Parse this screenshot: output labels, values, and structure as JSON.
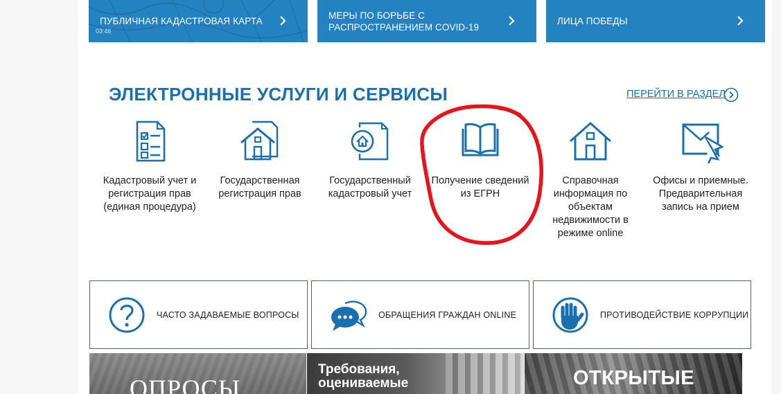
{
  "banners": [
    {
      "label": "Публичная кадастровая карта"
    },
    {
      "label": "Меры по борьбе с распространением COVID-19"
    },
    {
      "label": "Лица победы"
    }
  ],
  "map_number": "03:46",
  "section": {
    "title": "ЭЛЕКТРОННЫЕ УСЛУГИ И СЕРВИСЫ",
    "goto_label": "Перейти в раздел"
  },
  "services": [
    {
      "label": "Кадастровый учет и регистрация прав (единая процедура)",
      "icon": "form-document-icon"
    },
    {
      "label": "Государственная регистрация прав",
      "icon": "house-document-icon"
    },
    {
      "label": "Государственный кадастровый учет",
      "icon": "house-circle-document-icon"
    },
    {
      "label": "Получение сведений из ЕГРН",
      "icon": "open-book-icon"
    },
    {
      "label": "Справочная информация по объектам недвижимости в режиме online",
      "icon": "house-icon"
    },
    {
      "label": "Офисы и приемные. Предварительная запись на прием",
      "icon": "envelope-cursor-icon"
    }
  ],
  "quick_links": [
    {
      "label": "Часто задаваемые вопросы",
      "icon": "question-circle-icon"
    },
    {
      "label": "Обращения граждан online",
      "icon": "chat-bubbles-icon"
    },
    {
      "label": "Противодействие коррупции",
      "icon": "stop-hand-icon"
    }
  ],
  "photos": [
    {
      "text": "ОПРОСЫ"
    },
    {
      "text": "Требования, оцениваемые"
    },
    {
      "text": "ОТКРЫТЫЕ"
    }
  ],
  "colors": {
    "brand_blue": "#2382bf",
    "title_blue": "#1a6fae",
    "annotation_red": "#e8141c"
  }
}
